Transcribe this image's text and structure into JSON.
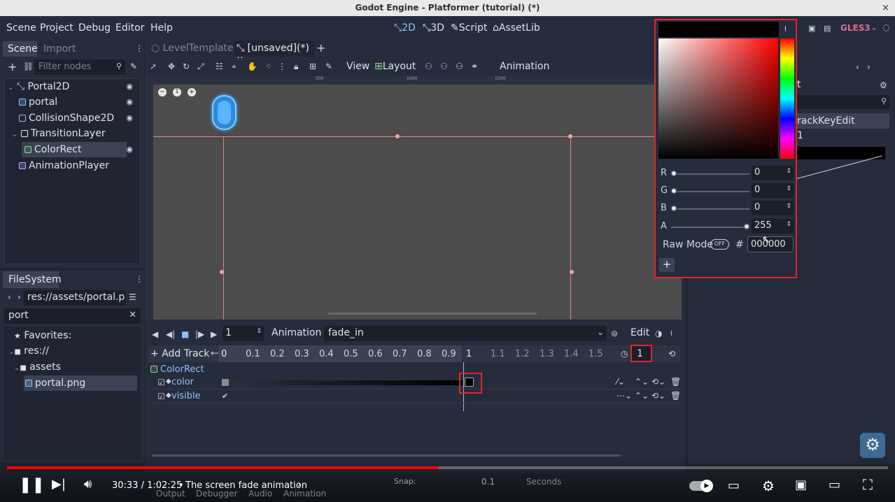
{
  "window": {
    "title": "Godot Engine - Platformer (tutorial) (*)",
    "close": "×"
  },
  "menu": [
    "Scene",
    "Project",
    "Debug",
    "Editor",
    "Help"
  ],
  "workspaces": [
    "2D",
    "3D",
    "Script",
    "AssetLib"
  ],
  "renderer": "GLES3",
  "scene_dock": {
    "tabs": [
      "Scene",
      "Import"
    ],
    "filter_placeholder": "Filter nodes",
    "nodes": [
      {
        "label": "Portal2D"
      },
      {
        "label": "portal"
      },
      {
        "label": "CollisionShape2D"
      },
      {
        "label": "TransitionLayer"
      },
      {
        "label": "ColorRect"
      },
      {
        "label": "AnimationPlayer"
      }
    ]
  },
  "filesystem": {
    "title": "FileSystem",
    "path": "res://assets/portal.pn",
    "search": "port",
    "tree": [
      {
        "label": "Favorites:"
      },
      {
        "label": "res://"
      },
      {
        "label": "assets"
      },
      {
        "label": "portal.png"
      }
    ]
  },
  "editor_tabs": [
    "LevelTemplate",
    "[unsaved](*)"
  ],
  "toolbar": {
    "view": "View",
    "layout": "Layout",
    "animation": "Animation"
  },
  "ruler_marks": [
    "500",
    "1000",
    "1500"
  ],
  "animation_panel": {
    "frame": "1",
    "animation_label": "Animation",
    "animation_name": "fade_in",
    "edit": "Edit",
    "add_track": "Add Track",
    "timeline_ticks": [
      "0",
      "0.1",
      "0.2",
      "0.3",
      "0.4",
      "0.5",
      "0.6",
      "0.7",
      "0.8",
      "0.9",
      "1",
      "1.1",
      "1.2",
      "1.3",
      "1.4",
      "1.5"
    ],
    "length": "1",
    "tracks_group": "ColorRect",
    "tracks": [
      "color",
      "visible"
    ],
    "snap_label": "Snap:",
    "snap_value": "0.1",
    "snap_unit": "Seconds",
    "bottom_tabs": [
      "Output",
      "Debugger",
      "Audio",
      "Animation"
    ]
  },
  "inspector": {
    "partial_title": "it",
    "track_key": "rackKeyEdit",
    "value": "1"
  },
  "color_picker": {
    "channels": [
      {
        "label": "R",
        "value": "0",
        "level": 0
      },
      {
        "label": "G",
        "value": "0",
        "level": 0
      },
      {
        "label": "B",
        "value": "0",
        "level": 0
      },
      {
        "label": "A",
        "value": "255",
        "level": 1
      }
    ],
    "raw_mode": "Raw Mode",
    "raw_state": "OFF",
    "hash": "#",
    "hex": "000000",
    "add": "+"
  },
  "video_player": {
    "time": "30:33 / 1:02:25",
    "separator": "•",
    "chapter": "The screen fade animation",
    "progress": 0.489
  },
  "colors": {
    "accent": "#8fbfff",
    "highlight_red": "#e0262b",
    "yt_red": "#ff0000",
    "panel": "#262c3b"
  }
}
